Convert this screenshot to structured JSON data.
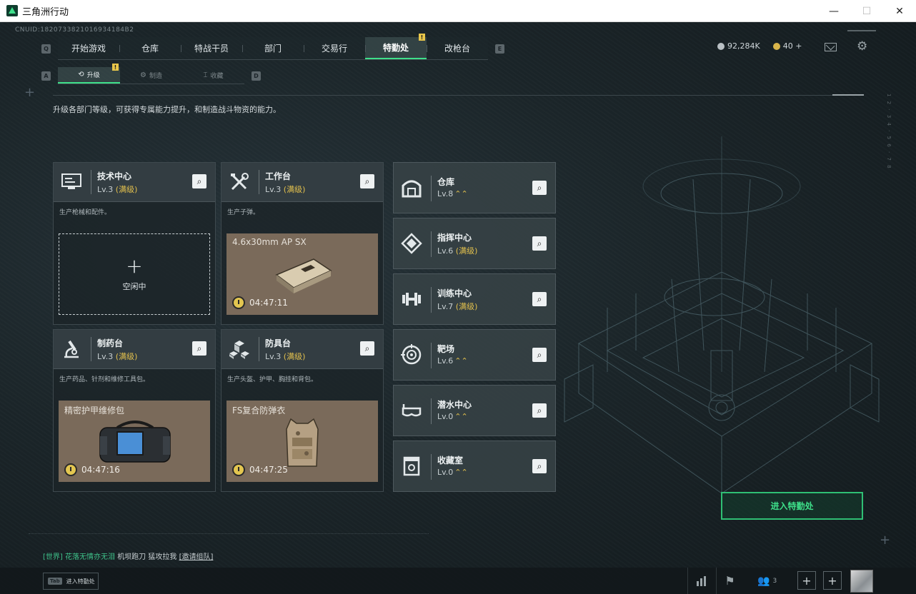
{
  "window": {
    "title": "三角洲行动",
    "minimize": "—",
    "maximize": "☐",
    "close": "✕"
  },
  "cnuid": "CNUID:1820733821016934184B2",
  "mainnav": {
    "left_key": "Q",
    "right_key": "E",
    "items": [
      "开始游戏",
      "仓库",
      "特战干员",
      "部门",
      "交易行",
      "特勤处",
      "改枪台"
    ],
    "active_index": 5,
    "badge": "!"
  },
  "currency": {
    "coins": "92,284K",
    "tokens": "40 +"
  },
  "subnav": {
    "left_key": "A",
    "right_key": "D",
    "items": [
      "升级",
      "制造",
      "收藏"
    ],
    "active_index": 0,
    "badge": "!"
  },
  "description": "升级各部门等级，可获得专属能力提升，和制造战斗物资的能力。",
  "cards": [
    {
      "name": "技术中心",
      "level": "Lv.3",
      "max": "(满级)",
      "desc": "生产枪械和配件。",
      "state": "idle",
      "idle_plus": "+",
      "idle_text": "空闲中"
    },
    {
      "name": "工作台",
      "level": "Lv.3",
      "max": "(满级)",
      "desc": "生产子弹。",
      "state": "producing",
      "product": "4.6x30mm AP SX",
      "timer": "04:47:11"
    },
    {
      "name": "制药台",
      "level": "Lv.3",
      "max": "(满级)",
      "desc": "生产药品、针剂和维修工具包。",
      "state": "producing",
      "product": "精密护甲维修包",
      "timer": "04:47:16"
    },
    {
      "name": "防具台",
      "level": "Lv.3",
      "max": "(满级)",
      "desc": "生产头盔、护甲、胸挂和背包。",
      "state": "producing",
      "product": "FS复合防弹衣",
      "timer": "04:47:25"
    }
  ],
  "departments": [
    {
      "name": "仓库",
      "level": "Lv.8",
      "max": "",
      "up": "⌃⌃"
    },
    {
      "name": "指挥中心",
      "level": "Lv.6",
      "max": "(满级)",
      "up": ""
    },
    {
      "name": "训练中心",
      "level": "Lv.7",
      "max": "(满级)",
      "up": ""
    },
    {
      "name": "靶场",
      "level": "Lv.6",
      "max": "",
      "up": "⌃⌃"
    },
    {
      "name": "潜水中心",
      "level": "Lv.0",
      "max": "",
      "up": "⌃⌃"
    },
    {
      "name": "收藏室",
      "level": "Lv.0",
      "max": "",
      "up": "⌃⌃"
    }
  ],
  "enter_button": "进入特勤处",
  "chat": {
    "channel": "[世界]",
    "user": "花落无情亦无泪",
    "message": "机坝跑刀 猛攻拉我",
    "link": "[邀请组队]"
  },
  "bottom": {
    "tab_key": "Tab",
    "tab_label": "进入特勤处",
    "people_count": "3"
  },
  "colors": {
    "accent": "#3ee08a",
    "max_level": "#e2c04d",
    "badge": "#e8c64a"
  }
}
